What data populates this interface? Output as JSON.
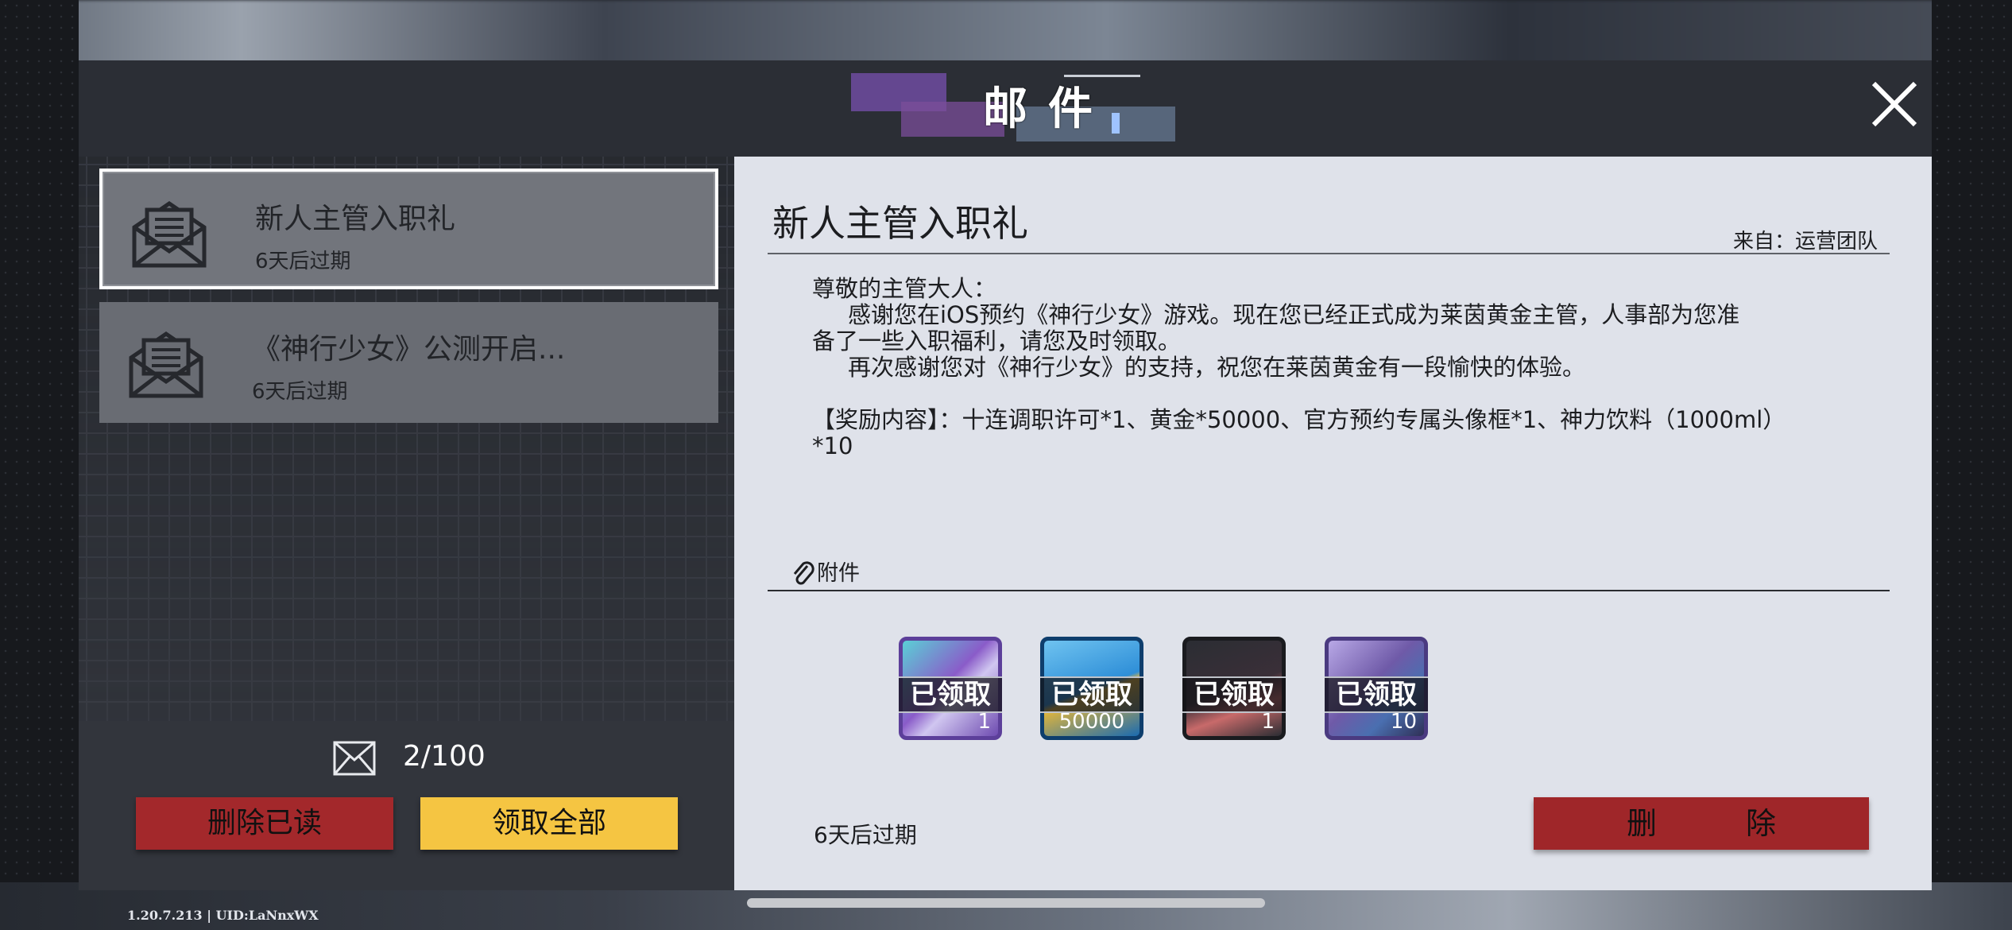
{
  "header": {
    "title": "邮件"
  },
  "mail_list": [
    {
      "title": "新人主管入职礼",
      "expire": "6天后过期",
      "selected": true
    },
    {
      "title": "《神行少女》公测开启...",
      "expire": "6天后过期",
      "selected": false
    }
  ],
  "footer": {
    "count": "2/100",
    "delete_read_label": "删除已读",
    "claim_all_label": "领取全部"
  },
  "detail": {
    "title": "新人主管入职礼",
    "from": "来自：运营团队",
    "greeting": "尊敬的主管大人：",
    "paragraph1": "感谢您在iOS预约《神行少女》游戏。现在您已经正式成为莱茵黄金主管，人事部为您准",
    "paragraph1_cont": "备了一些入职福利，请您及时领取。",
    "paragraph2": "再次感谢您对《神行少女》的支持，祝您在莱茵黄金有一段愉快的体验。",
    "rewards_line": "【奖励内容】：十连调职许可*1、黄金*50000、官方预约专属头像框*1、神力饮料（1000ml）",
    "rewards_line_cont": "*10",
    "attachment_label": "附件",
    "expire": "6天后过期",
    "delete_label": "删 除"
  },
  "attachments": [
    {
      "status": "已领取",
      "qty": "1",
      "color": "#8a5cc9"
    },
    {
      "status": "已领取",
      "qty": "50000",
      "color": "#2f8fd8"
    },
    {
      "status": "已领取",
      "qty": "1",
      "color": "#2b2d33"
    },
    {
      "status": "已领取",
      "qty": "10",
      "color": "#6f5aa8"
    }
  ],
  "version": "1.20.7.213 | UID:LaNnxWX"
}
